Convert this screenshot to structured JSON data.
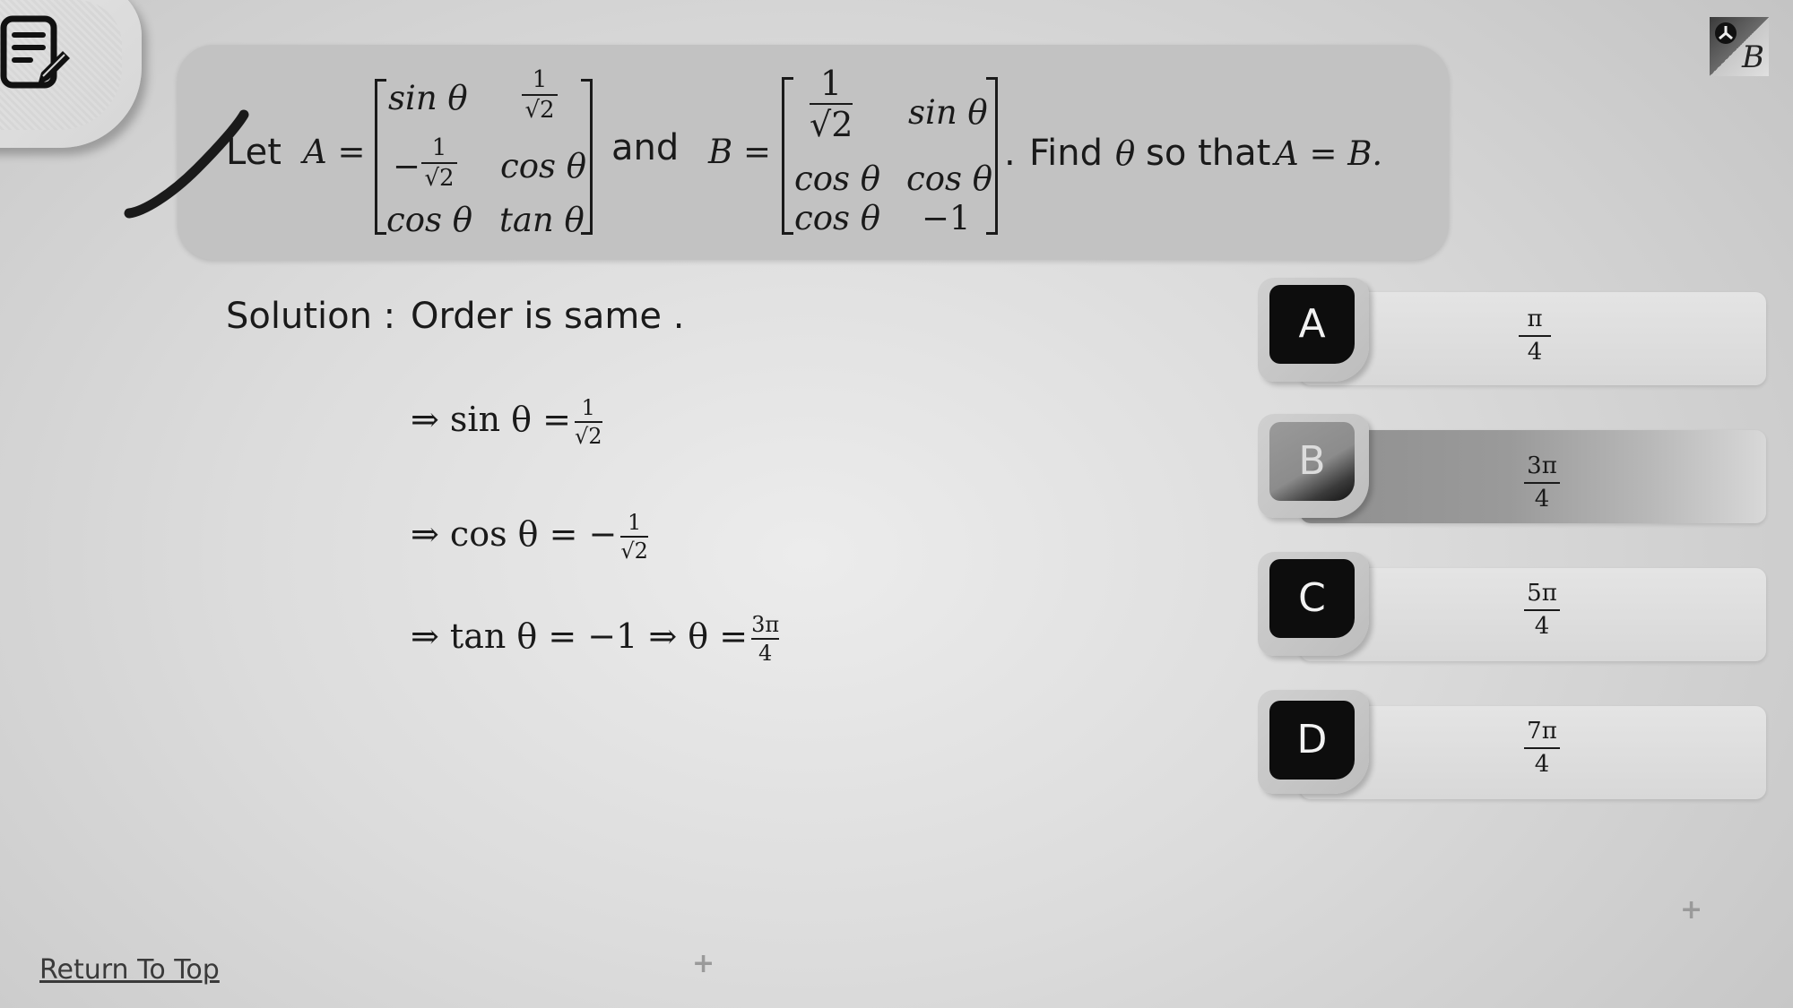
{
  "notes": {
    "icon": "notes-edit-icon"
  },
  "top_right": {
    "icon": "logo-badge-icon",
    "letter": "B"
  },
  "question": {
    "let": "Let",
    "A_eq": "A =",
    "and": "and",
    "B_eq": "B =",
    "period": ".",
    "find": "Find",
    "theta": "θ",
    "so_that": "so that",
    "condition": "A = B.",
    "matrix_A": {
      "r1c1": "sin θ",
      "r1c2_num": "1",
      "r1c2_den": "√2",
      "r2c1_sign": "−",
      "r2c1_num": "1",
      "r2c1_den": "√2",
      "r2c2": "cos θ",
      "r3c1": "cos θ",
      "r3c2": "tan θ"
    },
    "matrix_B": {
      "r1c1_num": "1",
      "r1c1_den": "√2",
      "r1c2": "sin θ",
      "r2c1": "cos θ",
      "r2c2": "cos θ",
      "r3c1": "cos θ",
      "r3c2": "−1"
    }
  },
  "solution": {
    "label": "Solution :",
    "line1": "Order is same .",
    "step1": {
      "text": "⇒ sin θ =",
      "num": "1",
      "den": "√2"
    },
    "step2": {
      "text": "⇒ cos θ = −",
      "num": "1",
      "den": "√2"
    },
    "step3": {
      "text": "⇒ tan θ = −1 ⇒ θ =",
      "num": "3π",
      "den": "4"
    }
  },
  "options": [
    {
      "key": "A",
      "num": "π",
      "den": "4",
      "selected": false
    },
    {
      "key": "B",
      "num": "3π",
      "den": "4",
      "selected": true
    },
    {
      "key": "C",
      "num": "5π",
      "den": "4",
      "selected": false
    },
    {
      "key": "D",
      "num": "7π",
      "den": "4",
      "selected": false
    }
  ],
  "footer": {
    "return_link": "Return To Top",
    "plus": "+"
  }
}
